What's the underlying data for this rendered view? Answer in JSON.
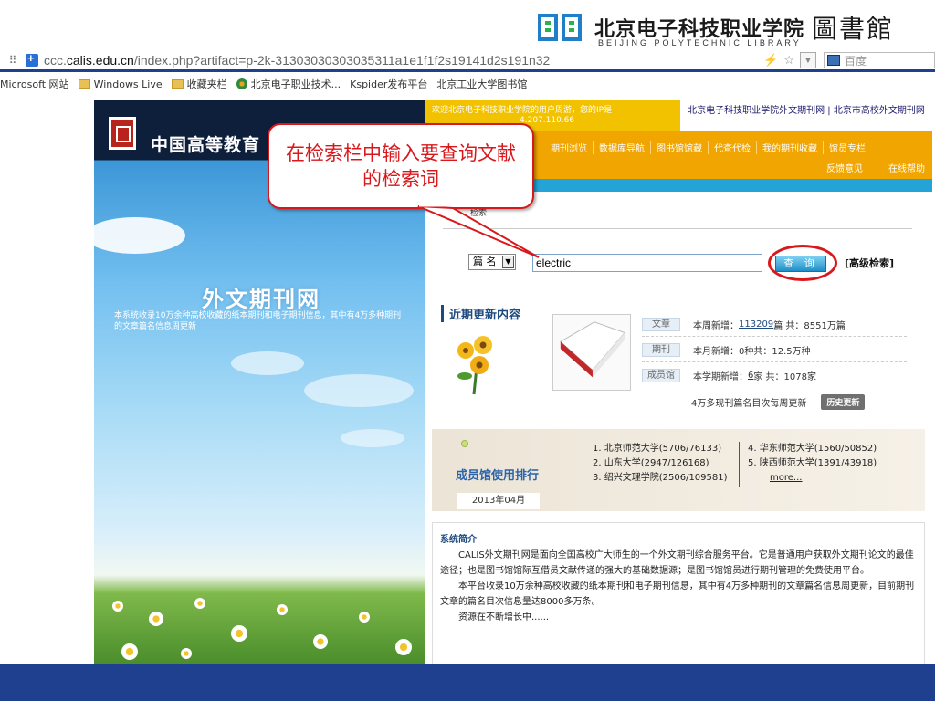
{
  "slide_header": {
    "school_name": "北京电子科技职业学院",
    "library_cn": "圖書館",
    "school_en": "BEIJING POLYTECHNIC LIBRARY"
  },
  "browser": {
    "url_prefix": "ccc.",
    "url_domain": "calis.edu.cn",
    "url_path": "/index.php?artifact=p-2k-31303030303035311a1e1f1f2s19141d2s191n32",
    "search_placeholder": "百度",
    "bookmarks": [
      {
        "label": "Microsoft 网站",
        "icon": "none"
      },
      {
        "label": "Windows Live",
        "icon": "folder"
      },
      {
        "label": "收藏夹栏",
        "icon": "folder"
      },
      {
        "label": "北京电子职业技术...",
        "icon": "flower"
      },
      {
        "label": "Kspider发布平台",
        "icon": "page"
      },
      {
        "label": "北京工业大学图书馆",
        "icon": "page"
      }
    ]
  },
  "site": {
    "title": "中国高等教育",
    "big_title": "外文期刊网",
    "description": "本系统收录10万余种高校收藏的纸本期刊和电子期刊信息，其中有4万多种期刊的文章篇名信息周更新",
    "welcome_line1": "欢迎北京电子科技职业学院的用户周游，您的IP是",
    "welcome_line2": "4.207.110.66",
    "topbar_right": "北京电子科技职业学院外文期刊网 | 北京市高校外文期刊网",
    "nav": [
      "期刊浏览",
      "数据库导航",
      "图书馆馆藏",
      "代查代检",
      "我的期刊收藏",
      "馆员专栏"
    ],
    "nav_sub": [
      "反馈意见",
      "在线帮助"
    ],
    "crumb": "检索",
    "search": {
      "field_label": "篇 名",
      "query": "electric",
      "button": "查 询",
      "advanced": "[高级检索]"
    },
    "recent": {
      "heading": "近期更新内容",
      "rows": [
        {
          "tag": "文章",
          "pre": "本周新增：",
          "count": "113209",
          "post": " 篇  共：8551万篇"
        },
        {
          "tag": "期刊",
          "pre": "本月新增：",
          "count": "0种",
          "post": "  共：12.5万种"
        },
        {
          "tag": "成员馆",
          "pre": "本学期新增：",
          "count": "6",
          "post": " 家  共：1078家"
        }
      ],
      "note": "4万多现刊篇名目次每周更新",
      "history_btn": "历史更新"
    },
    "ranking": {
      "title": "成员馆使用排行",
      "date": "2013年04月",
      "left": [
        "1. 北京师范大学(5706/76133)",
        "2. 山东大学(2947/126168)",
        "3. 绍兴文理学院(2506/109581)"
      ],
      "right": [
        "4. 华东师范大学(1560/50852)",
        "5. 陕西师范大学(1391/43918)"
      ],
      "more": "more..."
    },
    "intro": {
      "title": "系统简介",
      "p1": "CALIS外文期刊网是面向全国高校广大师生的一个外文期刊综合服务平台。它是普通用户获取外文期刊论文的最佳途径；也是图书馆馆际互借员文献传递的强大的基础数据源；是图书馆馆员进行期刊管理的免费使用平台。",
      "p2": "本平台收录10万余种高校收藏的纸本期刊和电子期刊信息，其中有4万多种期刊的文章篇名信息周更新，目前期刊文章的篇名目次信息量达8000多万条。",
      "p3": "资源在不断增长中......"
    }
  },
  "callout": {
    "text": "在检索栏中输入要查询文献的检索词"
  },
  "colors": {
    "accent_red": "#d9181c",
    "brand_blue": "#1f3f8f",
    "nav_orange": "#f0a500"
  }
}
